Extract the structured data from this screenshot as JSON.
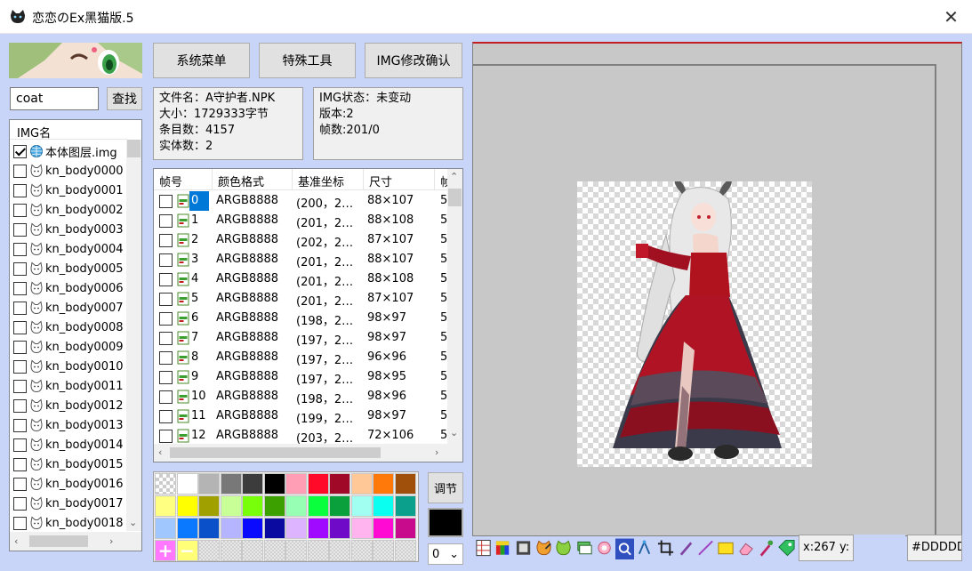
{
  "window": {
    "title": "恋恋のEx黑猫版.5",
    "close_glyph": "✕"
  },
  "search": {
    "value": "coat",
    "button_label": "查找"
  },
  "img_list": {
    "header": "IMG名",
    "items": [
      {
        "name": "本体图层.img",
        "checked": true,
        "icon": "globe-icon"
      },
      {
        "name": "kn_body0000",
        "checked": false,
        "icon": "cat-icon"
      },
      {
        "name": "kn_body0001",
        "checked": false,
        "icon": "cat-icon"
      },
      {
        "name": "kn_body0002",
        "checked": false,
        "icon": "cat-icon"
      },
      {
        "name": "kn_body0003",
        "checked": false,
        "icon": "cat-icon"
      },
      {
        "name": "kn_body0004",
        "checked": false,
        "icon": "cat-icon"
      },
      {
        "name": "kn_body0005",
        "checked": false,
        "icon": "cat-icon"
      },
      {
        "name": "kn_body0006",
        "checked": false,
        "icon": "cat-icon"
      },
      {
        "name": "kn_body0007",
        "checked": false,
        "icon": "cat-icon"
      },
      {
        "name": "kn_body0008",
        "checked": false,
        "icon": "cat-icon"
      },
      {
        "name": "kn_body0009",
        "checked": false,
        "icon": "cat-icon"
      },
      {
        "name": "kn_body0010",
        "checked": false,
        "icon": "cat-icon"
      },
      {
        "name": "kn_body0011",
        "checked": false,
        "icon": "cat-icon"
      },
      {
        "name": "kn_body0012",
        "checked": false,
        "icon": "cat-icon"
      },
      {
        "name": "kn_body0013",
        "checked": false,
        "icon": "cat-icon"
      },
      {
        "name": "kn_body0014",
        "checked": false,
        "icon": "cat-icon"
      },
      {
        "name": "kn_body0015",
        "checked": false,
        "icon": "cat-icon"
      },
      {
        "name": "kn_body0016",
        "checked": false,
        "icon": "cat-icon"
      },
      {
        "name": "kn_body0017",
        "checked": false,
        "icon": "cat-icon"
      },
      {
        "name": "kn_body0018",
        "checked": false,
        "icon": "cat-icon"
      }
    ]
  },
  "toolbar_buttons": {
    "system_menu": "系统菜单",
    "special_tools": "特殊工具",
    "img_confirm": "IMG修改确认"
  },
  "file_info": {
    "filename": "文件名：A守护者.NPK",
    "size": "大小：1729333字节",
    "entries": "条目数：4157",
    "entities": "实体数：2"
  },
  "img_info": {
    "status": "IMG状态：未变动",
    "version": "版本:2",
    "frames": "帧数:201/0"
  },
  "frame_table": {
    "columns": [
      "帧号",
      "颜色格式",
      "基准坐标",
      "尺寸",
      "帧"
    ],
    "rows": [
      {
        "idx": "0",
        "format": "ARGB8888",
        "base": "(200，2…",
        "size": "88×107",
        "more": "5",
        "selected": true
      },
      {
        "idx": "1",
        "format": "ARGB8888",
        "base": "(201，2…",
        "size": "88×108",
        "more": "5",
        "selected": false
      },
      {
        "idx": "2",
        "format": "ARGB8888",
        "base": "(202，2…",
        "size": "87×107",
        "more": "5",
        "selected": false
      },
      {
        "idx": "3",
        "format": "ARGB8888",
        "base": "(201，2…",
        "size": "88×107",
        "more": "5",
        "selected": false
      },
      {
        "idx": "4",
        "format": "ARGB8888",
        "base": "(201，2…",
        "size": "88×108",
        "more": "5",
        "selected": false
      },
      {
        "idx": "5",
        "format": "ARGB8888",
        "base": "(201，2…",
        "size": "87×107",
        "more": "5",
        "selected": false
      },
      {
        "idx": "6",
        "format": "ARGB8888",
        "base": "(198，2…",
        "size": "98×97",
        "more": "5",
        "selected": false
      },
      {
        "idx": "7",
        "format": "ARGB8888",
        "base": "(197，2…",
        "size": "98×97",
        "more": "5",
        "selected": false
      },
      {
        "idx": "8",
        "format": "ARGB8888",
        "base": "(197，2…",
        "size": "96×96",
        "more": "5",
        "selected": false
      },
      {
        "idx": "9",
        "format": "ARGB8888",
        "base": "(197，2…",
        "size": "98×95",
        "more": "5",
        "selected": false
      },
      {
        "idx": "10",
        "format": "ARGB8888",
        "base": "(198，2…",
        "size": "98×96",
        "more": "5",
        "selected": false
      },
      {
        "idx": "11",
        "format": "ARGB8888",
        "base": "(199，2…",
        "size": "98×97",
        "more": "5",
        "selected": false
      },
      {
        "idx": "12",
        "format": "ARGB8888",
        "base": "(203，2…",
        "size": "72×106",
        "more": "5",
        "selected": false
      }
    ]
  },
  "palette": {
    "rows": [
      [
        "transparent",
        "#ffffff",
        "#b4b4b4",
        "#787878",
        "#3c3c3c",
        "#000000",
        "#ff9eb4",
        "#ff0a28",
        "#a00a28",
        "#ffc896",
        "#ff780a",
        "#a0500a"
      ],
      [
        "#ffff82",
        "#ffff00",
        "#a0a000",
        "#c8ff96",
        "#78ff0a",
        "#3ca000",
        "#96ffb4",
        "#0aff3c",
        "#0aa03c",
        "#a0fff0",
        "#0afff0",
        "#0aa08c"
      ],
      [
        "#a0c8ff",
        "#0a78ff",
        "#0a50c8",
        "#b4b4ff",
        "#0a0aff",
        "#0a0aa0",
        "#dcb4ff",
        "#a00aff",
        "#6e0ac8",
        "#ffb4f0",
        "#ff0ad2",
        "#c80a8c"
      ],
      [
        "#ff78ff",
        "#ffff78",
        "empty",
        "empty",
        "empty",
        "empty",
        "empty",
        "empty",
        "empty",
        "empty",
        "empty",
        "empty"
      ]
    ],
    "add_symbol": "+",
    "remove_symbol": "−"
  },
  "adjust_label": "调节",
  "current_color": "#000000",
  "zoom": {
    "value": "0",
    "arrow": "⌄"
  },
  "tools": [
    "frame-grid-icon",
    "color-bars-icon",
    "film-icon",
    "cat-edit-icon",
    "cat-paint-icon",
    "layers-icon",
    "gear-flower-icon",
    "magnifier-icon",
    "move-icon",
    "crop-icon",
    "pencil-icon",
    "line-icon",
    "rectangle-icon",
    "eraser-icon",
    "eyedropper-icon",
    "tag-icon"
  ],
  "coordinates": "x:267 y:",
  "color_hex": "#DDDDDD"
}
